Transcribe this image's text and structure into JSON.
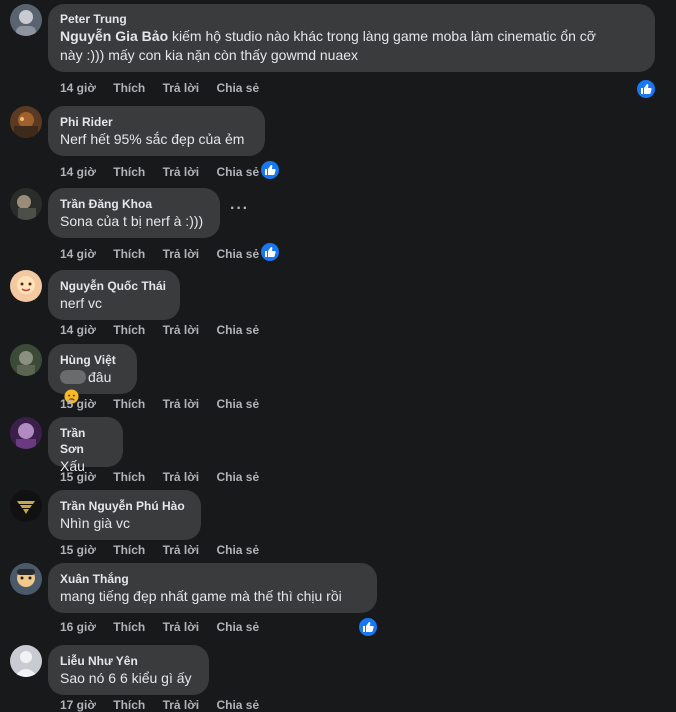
{
  "comments": [
    {
      "author": "Peter Trung",
      "mention": "Nguyễn Gia Bảo",
      "text_line1": " kiếm hộ studio nào khác trong làng game moba làm cinematic ổn cỡ",
      "text_line2": "này :))) mấy con kia nặn còn thấy gowmd nuaex",
      "time": "14 giờ",
      "like": "Thích",
      "reply": "Trả lời",
      "share": "Chia sẻ",
      "reacted": true
    },
    {
      "author": "Phi Rider",
      "text": "Nerf hết 95% sắc đẹp của ẻm",
      "time": "14 giờ",
      "like": "Thích",
      "reply": "Trả lời",
      "share": "Chia sẻ",
      "reacted": true
    },
    {
      "author": "Trần Đăng Khoa",
      "text": "Sona của t bị nerf à :)))",
      "time": "14 giờ",
      "like": "Thích",
      "reply": "Trả lời",
      "share": "Chia sẻ",
      "reacted": true,
      "more": "···"
    },
    {
      "author": "Nguyễn Quốc Thái",
      "text": "nerf vc",
      "time": "14 giờ",
      "like": "Thích",
      "reply": "Trả lời",
      "share": "Chia sẻ",
      "reacted": false
    },
    {
      "author": "Hùng Việt",
      "text": "đâu",
      "time": "15 giờ",
      "like": "Thích",
      "reply": "Trả lời",
      "share": "Chia sẻ",
      "reacted": false
    },
    {
      "author": "Trần Sơn",
      "text": "Xấu",
      "time": "15 giờ",
      "like": "Thích",
      "reply": "Trả lời",
      "share": "Chia sẻ",
      "reacted": false
    },
    {
      "author": "Trần Nguyễn Phú Hào",
      "text": "Nhìn già vc",
      "time": "15 giờ",
      "like": "Thích",
      "reply": "Trả lời",
      "share": "Chia sẻ",
      "reacted": false
    },
    {
      "author": "Xuân Thắng",
      "text": "mang tiếng đẹp nhất game mà thế thì chịu rồi",
      "time": "16 giờ",
      "like": "Thích",
      "reply": "Trả lời",
      "share": "Chia sẻ",
      "reacted": true
    },
    {
      "author": "Liễu Như Yên",
      "text": "Sao nó 6 6 kiểu gì ấy",
      "time": "17 giờ",
      "like": "Thích",
      "reply": "Trả lời",
      "share": "Chia sẻ",
      "reacted": false
    }
  ],
  "icons": {
    "like_reaction": "thumbs-up-icon",
    "more": "more-options-icon",
    "emoji": "sad-face-emoji-icon"
  },
  "colors": {
    "background": "#18191a",
    "bubble": "#3a3b3c",
    "text": "#e4e6eb",
    "secondary": "#b0b3b8",
    "like_blue": "#1877f2"
  }
}
